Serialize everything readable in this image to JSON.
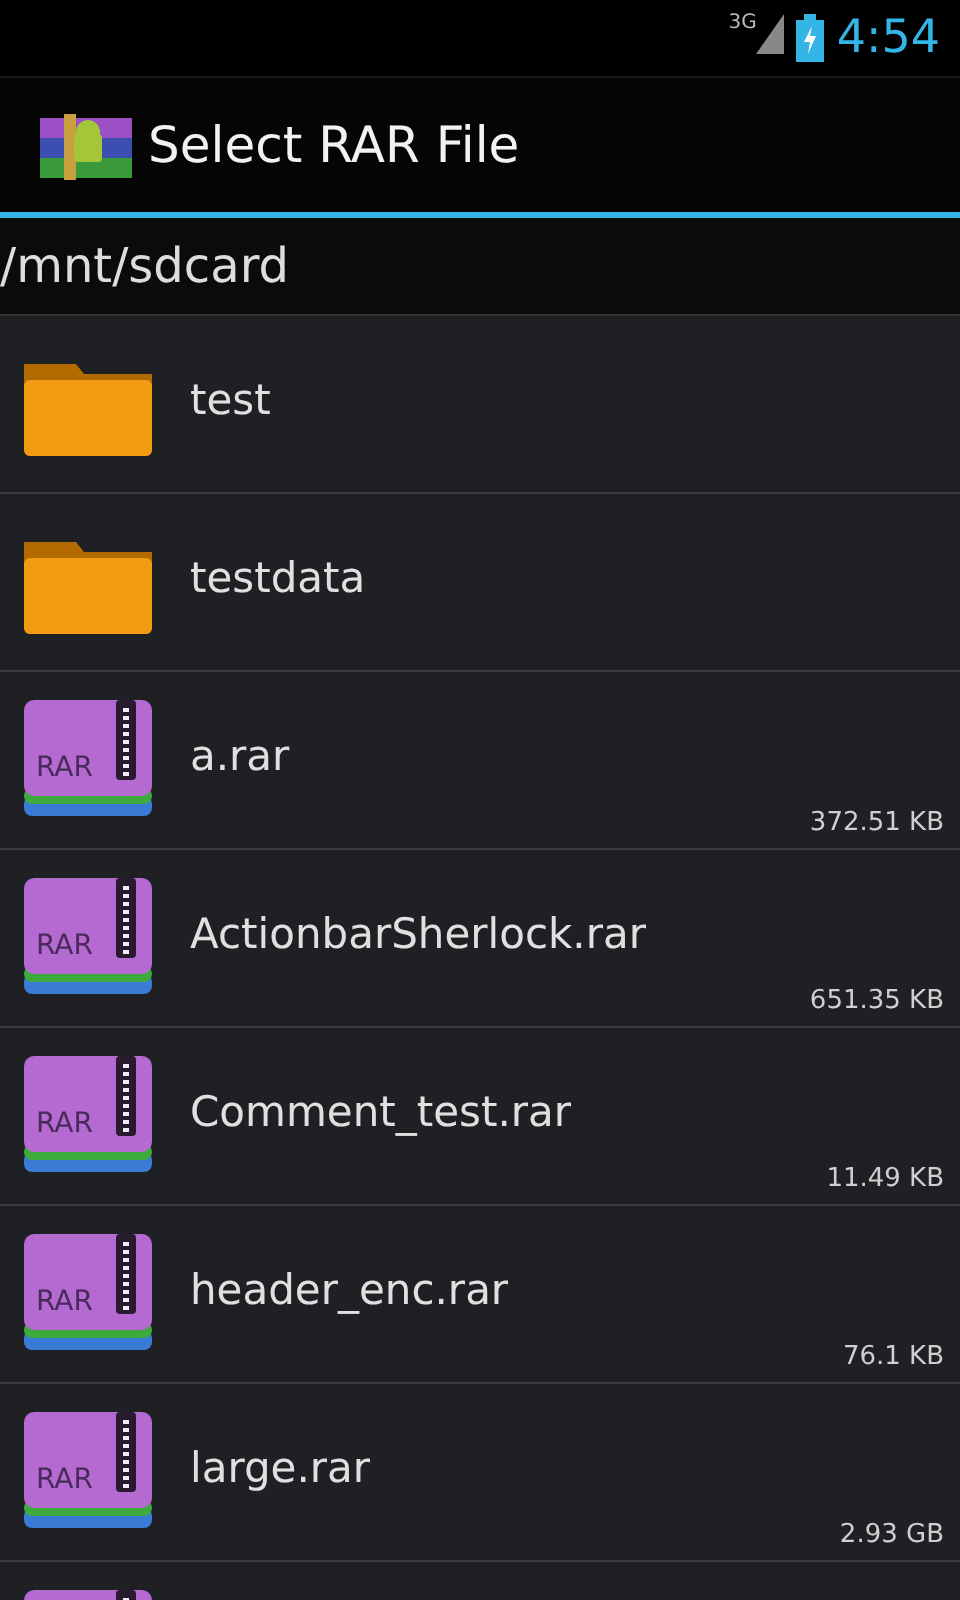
{
  "status_bar": {
    "network": "3G",
    "time": "4:54"
  },
  "action_bar": {
    "title": "Select RAR File"
  },
  "path": "/mnt/sdcard",
  "files": [
    {
      "kind": "folder",
      "name": "test"
    },
    {
      "kind": "folder",
      "name": "testdata"
    },
    {
      "kind": "rar",
      "icon_label": "RAR",
      "name": "a.rar",
      "size": "372.51 KB"
    },
    {
      "kind": "rar",
      "icon_label": "RAR",
      "name": "ActionbarSherlock.rar",
      "size": "651.35 KB"
    },
    {
      "kind": "rar",
      "icon_label": "RAR",
      "name": "Comment_test.rar",
      "size": "11.49 KB"
    },
    {
      "kind": "rar",
      "icon_label": "RAR",
      "name": "header_enc.rar",
      "size": "76.1 KB"
    },
    {
      "kind": "rar",
      "icon_label": "RAR",
      "name": "large.rar",
      "size": "2.93 GB"
    },
    {
      "kind": "rar"
    }
  ]
}
